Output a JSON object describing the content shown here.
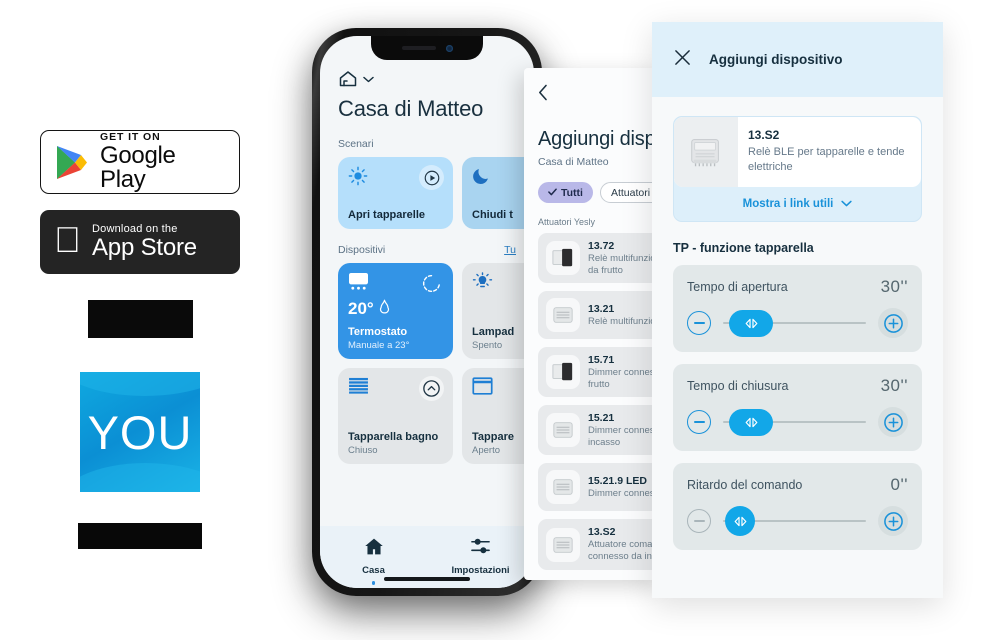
{
  "badges": {
    "google": {
      "small": "GET IT ON",
      "big": "Google Play",
      "icon": "google-play-icon"
    },
    "apple": {
      "small": "Download on the",
      "big": "App Store",
      "icon": "apple-logo-icon"
    },
    "you_logo_text": "YOU"
  },
  "phone": {
    "home_label": "Casa di Matteo",
    "scenari_label": "Scenari",
    "dispositivi_label": "Dispositivi",
    "dispositivi_link": "Tu",
    "scenes": [
      {
        "name": "Apri tapparelle",
        "icon": "sun-icon"
      },
      {
        "name": "Chiudi t",
        "icon": "moon-icon"
      }
    ],
    "devices": [
      {
        "title": "Termostato",
        "value": "20°",
        "sub": "Manuale a 23°",
        "icon": "thermostat-icon",
        "action": "refresh-icon",
        "active": true
      },
      {
        "title": "Lampad",
        "sub": "Spento",
        "icon": "lamp-icon",
        "active": false
      },
      {
        "title": "Tapparella bagno",
        "sub": "Chiuso",
        "icon": "shutter-closed-icon",
        "action": "chevron-up-icon",
        "active": false
      },
      {
        "title": "Tappare",
        "sub": "Aperto",
        "icon": "shutter-open-icon",
        "active": false
      }
    ],
    "tabs": [
      {
        "label": "Casa",
        "icon": "home-icon",
        "active": true
      },
      {
        "label": "Impostazioni",
        "icon": "sliders-icon",
        "active": false
      }
    ]
  },
  "mid_panel": {
    "back_icon": "chevron-left-icon",
    "title": "Aggiungi dispos",
    "subtitle": "Casa di Matteo",
    "chips": [
      {
        "label": "Tutti",
        "selected": true,
        "icon": "check-icon"
      },
      {
        "label": "Attuatori Yesly",
        "selected": false
      }
    ],
    "group_label": "Attuatori Yesly",
    "items": [
      {
        "name": "13.72",
        "desc": "Relè multifunzione da frutto"
      },
      {
        "name": "13.21",
        "desc": "Relè multifunzione"
      },
      {
        "name": "15.71",
        "desc": "Dimmer connesso frutto"
      },
      {
        "name": "15.21",
        "desc": "Dimmer connesso incasso"
      },
      {
        "name": "15.21.9 LED",
        "desc": "Dimmer connesso"
      },
      {
        "name": "13.S2",
        "desc": "Attuatore comando connesso da incas"
      }
    ]
  },
  "right_panel": {
    "close_icon": "close-icon",
    "title": "Aggiungi dispositivo",
    "product": {
      "name": "13.S2",
      "desc": "Relè BLE per tapparelle e tende elettriche",
      "link_label": "Mostra i link utili",
      "link_icon": "chevron-down-icon",
      "image_icon": "relay-module-icon"
    },
    "section_title": "TP - funzione tapparella",
    "sliders": [
      {
        "label": "Tempo di apertura",
        "value": "30''",
        "fill": 0,
        "minus_enabled": true,
        "thumb": "wide"
      },
      {
        "label": "Tempo di chiusura",
        "value": "30''",
        "fill": 0,
        "minus_enabled": true,
        "thumb": "wide"
      },
      {
        "label": "Ritardo del comando",
        "value": "0''",
        "fill": 0,
        "minus_enabled": false,
        "thumb": "round"
      }
    ]
  },
  "colors": {
    "accent_blue": "#1a92d9",
    "thumb_blue": "#12a7e8",
    "card_blue": "#b5dffb",
    "active_card": "#3394e6",
    "panel_head": "#dff0fa",
    "chip_selected": "#b9b8e8"
  }
}
